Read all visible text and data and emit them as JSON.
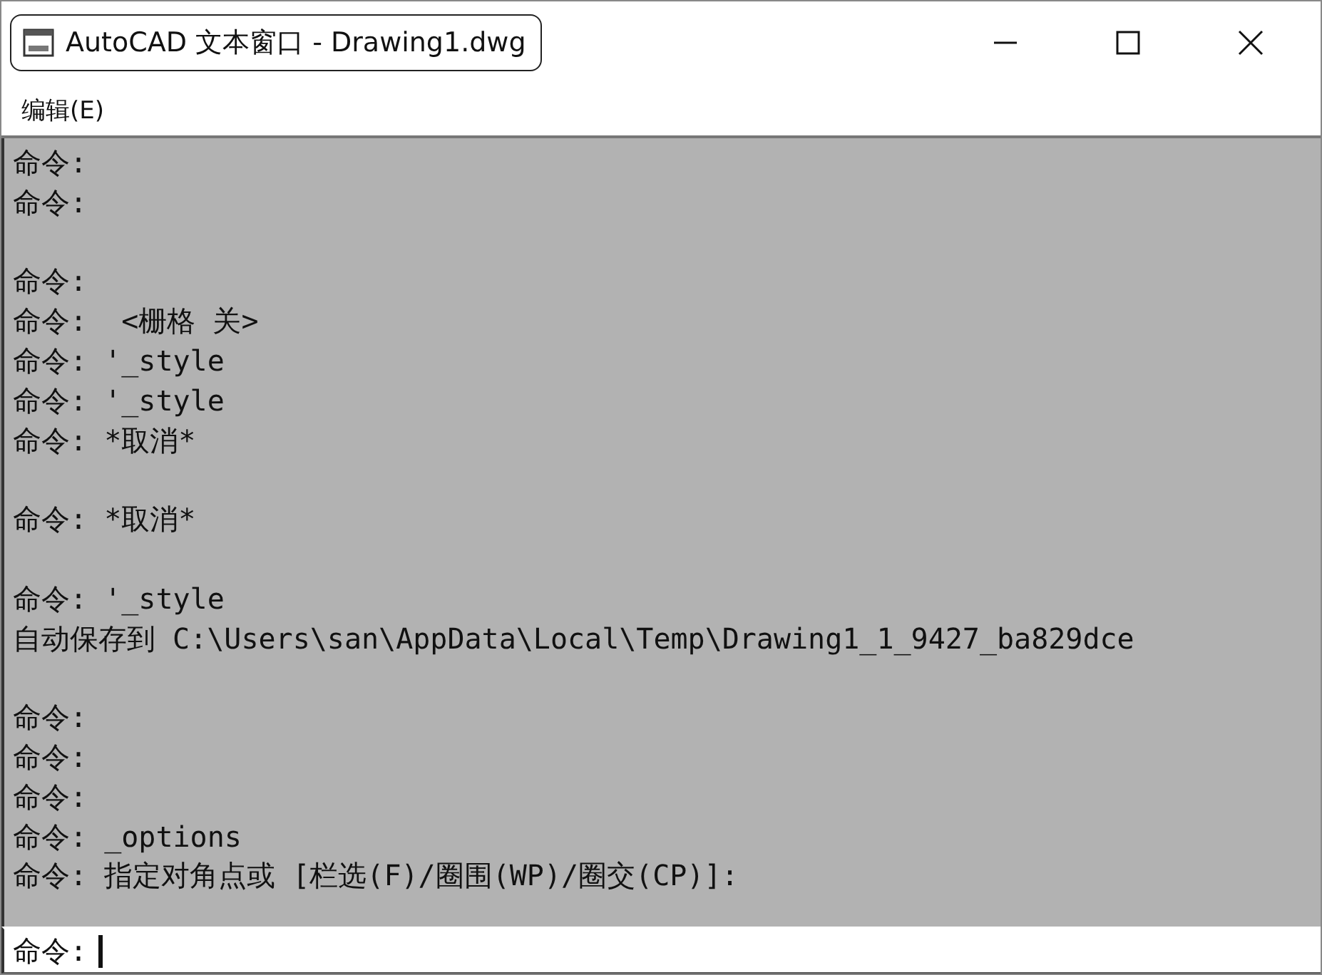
{
  "window": {
    "title": "AutoCAD 文本窗口 - Drawing1.dwg",
    "controls": [
      {
        "kind": "minimize"
      },
      {
        "kind": "maximize"
      },
      {
        "kind": "close"
      }
    ]
  },
  "menu": [
    {
      "label": "编辑(E)"
    }
  ],
  "history": [
    {
      "kind": "line",
      "text": "命令:"
    },
    {
      "kind": "line",
      "text": "命令:"
    },
    {
      "kind": "gap"
    },
    {
      "kind": "line",
      "text": "命令:"
    },
    {
      "kind": "line",
      "text": "命令:  <栅格 关>"
    },
    {
      "kind": "line",
      "text": "命令: '_style"
    },
    {
      "kind": "line",
      "text": "命令: '_style"
    },
    {
      "kind": "line",
      "text": "命令: *取消*"
    },
    {
      "kind": "gap"
    },
    {
      "kind": "line",
      "text": "命令: *取消*"
    },
    {
      "kind": "gap"
    },
    {
      "kind": "line",
      "text": "命令: '_style"
    },
    {
      "kind": "line",
      "text": "自动保存到 C:\\Users\\san\\AppData\\Local\\Temp\\Drawing1_1_9427_ba829dce"
    },
    {
      "kind": "gap"
    },
    {
      "kind": "line",
      "text": "命令:"
    },
    {
      "kind": "line",
      "text": "命令:"
    },
    {
      "kind": "line",
      "text": "命令:"
    },
    {
      "kind": "line",
      "text": "命令: _options"
    },
    {
      "kind": "line",
      "text": "命令: 指定对角点或 [栏选(F)/圈围(WP)/圈交(CP)]:"
    }
  ],
  "command_line": {
    "prompt": "命令:"
  }
}
